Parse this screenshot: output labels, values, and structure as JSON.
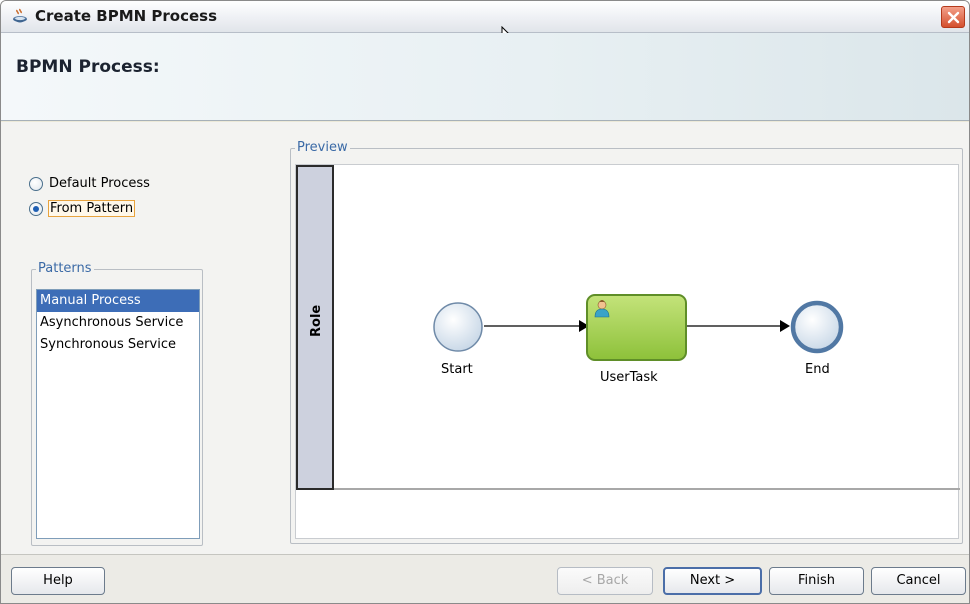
{
  "window": {
    "title": "Create BPMN Process"
  },
  "header": {
    "title": "BPMN Process:"
  },
  "options": {
    "default_process": "Default Process",
    "from_pattern": "From Pattern",
    "selected": "From Pattern"
  },
  "patterns": {
    "legend": "Patterns",
    "items": [
      "Manual Process",
      "Asynchronous Service",
      "Synchronous Service"
    ],
    "selected": "Manual Process"
  },
  "preview": {
    "legend": "Preview",
    "lane_label": "Role",
    "nodes": {
      "start": "Start",
      "task": "UserTask",
      "end": "End"
    }
  },
  "footer": {
    "help": "Help",
    "back": "< Back",
    "next": "Next >",
    "finish": "Finish",
    "cancel": "Cancel"
  }
}
